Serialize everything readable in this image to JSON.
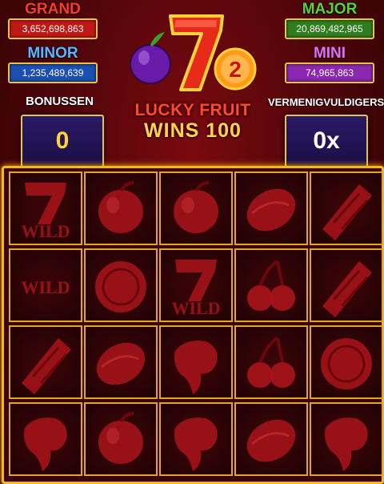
{
  "jackpots": {
    "grand": {
      "label": "GRAND",
      "value": "3,652,698,863"
    },
    "major": {
      "label": "MAJOR",
      "value": "20,869,482,965"
    },
    "minor": {
      "label": "MINOR",
      "value": "1,235,489,639"
    },
    "mini": {
      "label": "MINI",
      "value": "74,965,863"
    }
  },
  "logo": {
    "line1": "LUCKY FRUIT",
    "line2": "WINS 100"
  },
  "bonus": {
    "label": "BONUSSEN",
    "value": "0"
  },
  "multiplier": {
    "label": "VERMENIGVULDIGERS",
    "value": "0x"
  },
  "reels": [
    [
      "wild-seven",
      "plum",
      "plum",
      "lemon",
      "watermelon"
    ],
    [
      "wild-text",
      "orange",
      "wild-seven",
      "cherry",
      "watermelon"
    ],
    [
      "watermelon",
      "lemon",
      "grape",
      "cherry",
      "orange"
    ],
    [
      "grape",
      "plum",
      "grape",
      "lemon",
      "grape"
    ]
  ],
  "symbols": {
    "wild_label": "WILD"
  },
  "colors": {
    "gold": "#e8c24a",
    "symbol_red": "#a9141a",
    "background": "#4a0508"
  }
}
